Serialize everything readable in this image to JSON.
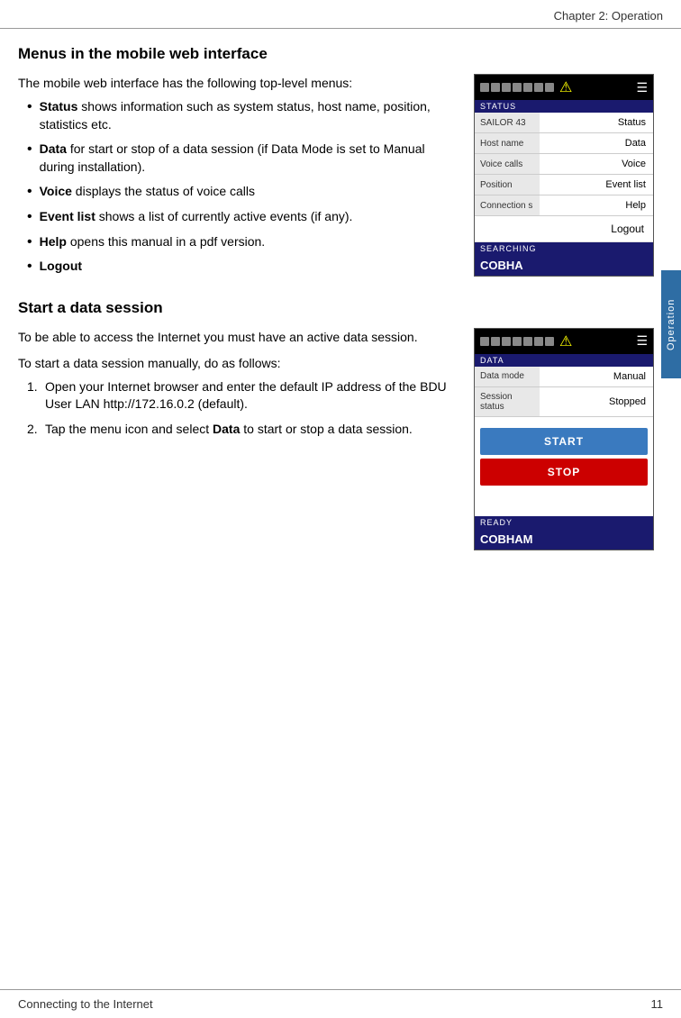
{
  "header": {
    "title": "Chapter 2:  Operation"
  },
  "section1": {
    "heading": "Menus in the mobile web interface",
    "intro": "The mobile web interface has the following top-level menus:",
    "bullets": [
      {
        "bold": "Status",
        "text": " shows information such as system status, host name, position, statistics etc."
      },
      {
        "bold": "Data",
        "text": " for start or stop of a data session (if Data Mode is set to Manual during installation)."
      },
      {
        "bold": "Voice",
        "text": " displays the status of voice calls"
      },
      {
        "bold": "Event list",
        "text": " shows a list of currently active events (if any)."
      },
      {
        "bold": "Help",
        "text": " opens this manual in a pdf version."
      },
      {
        "bold": "Logout",
        "text": ""
      }
    ],
    "phone1": {
      "top_bar_status": "SEARCHING",
      "status_label": "STATUS",
      "row1_left": "SAILOR 43",
      "row1_right": "Status",
      "row2_left": "Host name",
      "row2_right": "Data",
      "row3_left": "Voice calls",
      "row3_right": "Voice",
      "row4_left": "Position",
      "row4_right": "Event list",
      "row5_left": "Connection s",
      "row5_right": "Help",
      "logout": "Logout",
      "bottom_label": "SEARCHING",
      "logo": "COBHA"
    }
  },
  "section2": {
    "heading": "Start a data session",
    "intro1": "To be able to access the Internet you must have an active data session.",
    "intro2": "To start a data session manually, do as follows:",
    "steps": [
      {
        "num": "1.",
        "text": "Open your Internet browser and enter the default IP address of the BDU User LAN http://172.16.0.2 (default)."
      },
      {
        "num": "2.",
        "text": "Tap the menu icon and select Data to start or stop a data session."
      }
    ],
    "phone2": {
      "status_label": "DATA",
      "row1_left": "Data mode",
      "row1_right": "Manual",
      "row2_left": "Session status",
      "row2_right": "Stopped",
      "btn_start": "START",
      "btn_stop": "STOP",
      "bottom_label": "READY",
      "logo": "COBHAM"
    }
  },
  "footer": {
    "left": "Connecting to the Internet",
    "right": "11"
  },
  "sidebar_label": "Operation"
}
